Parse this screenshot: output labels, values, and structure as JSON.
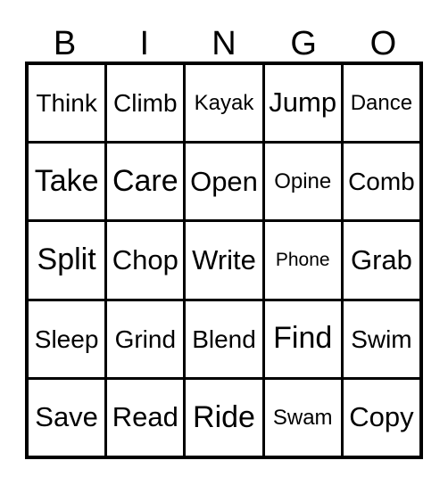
{
  "card": {
    "title": "BINGO",
    "colors": {
      "ink": "#000000",
      "paper": "#ffffff",
      "border": "#000000"
    },
    "header": {
      "letters": [
        "B",
        "I",
        "N",
        "G",
        "O"
      ]
    },
    "grid": {
      "columns": 5,
      "rows": 5,
      "cells": [
        [
          {
            "label": "Think",
            "size": "md"
          },
          {
            "label": "Climb",
            "size": "md"
          },
          {
            "label": "Kayak",
            "size": "sm"
          },
          {
            "label": "Jump",
            "size": "lg"
          },
          {
            "label": "Dance",
            "size": "sm"
          }
        ],
        [
          {
            "label": "Take",
            "size": "xl"
          },
          {
            "label": "Care",
            "size": "xl"
          },
          {
            "label": "Open",
            "size": "lg"
          },
          {
            "label": "Opine",
            "size": "sm"
          },
          {
            "label": "Comb",
            "size": "md"
          }
        ],
        [
          {
            "label": "Split",
            "size": "xl"
          },
          {
            "label": "Chop",
            "size": "lg"
          },
          {
            "label": "Write",
            "size": "lg"
          },
          {
            "label": "Phone",
            "size": "xs"
          },
          {
            "label": "Grab",
            "size": "lg"
          }
        ],
        [
          {
            "label": "Sleep",
            "size": "md"
          },
          {
            "label": "Grind",
            "size": "md"
          },
          {
            "label": "Blend",
            "size": "md"
          },
          {
            "label": "Find",
            "size": "xl"
          },
          {
            "label": "Swim",
            "size": "md"
          }
        ],
        [
          {
            "label": "Save",
            "size": "lg"
          },
          {
            "label": "Read",
            "size": "lg"
          },
          {
            "label": "Ride",
            "size": "xl"
          },
          {
            "label": "Swam",
            "size": "sm"
          },
          {
            "label": "Copy",
            "size": "lg"
          }
        ]
      ]
    }
  }
}
